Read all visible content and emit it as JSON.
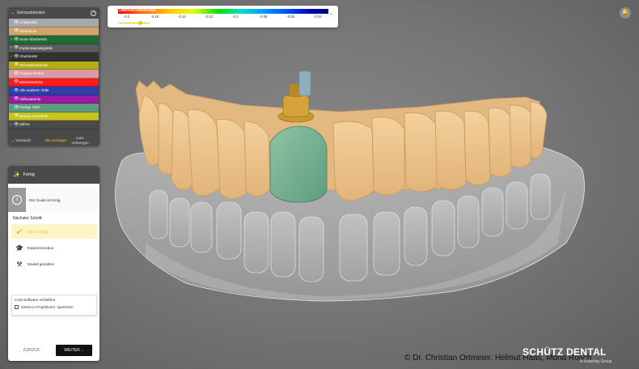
{
  "visibility_panel": {
    "header": "Ein/ausblenden",
    "help_icon": "question-circle-icon",
    "items": [
      {
        "label": "Antagonist",
        "color": "#a8a8a8",
        "expandable": false
      },
      {
        "label": "Kieferscan",
        "color": "#d3a46a",
        "expandable": false
      },
      {
        "label": "Scan-Abutments",
        "color": "#1e6b33",
        "expandable": true
      },
      {
        "label": "Implantatanalogteile",
        "color": "#5c5c5c",
        "expandable": true
      },
      {
        "label": "Abutments",
        "color": "#333333",
        "expandable": true
      },
      {
        "label": "Schraubenkanäle",
        "color": "#b5aa18",
        "expandable": false
      },
      {
        "label": "Gingiva-Scans",
        "color": "#d99aa6",
        "expandable": false
      },
      {
        "label": "Mindeststücke",
        "color": "#ff1a1a",
        "expandable": false
      },
      {
        "label": "Alle anderen Teile",
        "color": "#2a3faa",
        "expandable": false
      },
      {
        "label": "Vollanatomie",
        "color": "#9b1aa3",
        "expandable": false
      },
      {
        "label": "Fertige Teile",
        "color": "#5e9c7e",
        "expandable": false
      },
      {
        "label": "Design-Unterteile",
        "color": "#c6c41a",
        "expandable": false
      },
      {
        "label": "Zähne",
        "color": "#4a4a4a",
        "expandable": true
      }
    ],
    "footer": {
      "hidden_label": "Versteckt",
      "show_all_label": "Alle anzeigen",
      "auto_hide_label": "Auto-Verbergen"
    }
  },
  "deviation_scale": {
    "label": "ÜBERSCHNEIDUNG",
    "ticks": [
      "-0.2",
      "-0.18",
      "-0.15",
      "-0.13",
      "-0.1",
      "-0.08",
      "-0.05",
      "-0.03"
    ],
    "slider_fraction": 0.7
  },
  "guide_panel": {
    "title": "Fertig",
    "info_text": "Der Guide ist fertig.",
    "next_step_label": "Nächster Schritt:",
    "options": [
      {
        "label": "Ich bin fertig",
        "icon": "checkmark-icon",
        "selected": true
      },
      {
        "label": "Expertenmodus",
        "icon": "graduation-cap-icon",
        "selected": false
      },
      {
        "label": "Modell gestalten",
        "icon": "model-build-icon",
        "selected": false
      }
    ],
    "close_box": {
      "title": "CAD-Software schließen",
      "checkbox_label": "Szene in Projektverz. speichern"
    },
    "back_label": "ZURÜCK",
    "next_label": "WEITER"
  },
  "notification_icon": "bell-icon",
  "copyright": "© Dr. Christian Ortmeier, Helmut Haas, Mona Rösch",
  "brand": {
    "name": "SCHÜTZ DENTAL",
    "subtitle": "A Rübeling Group"
  }
}
